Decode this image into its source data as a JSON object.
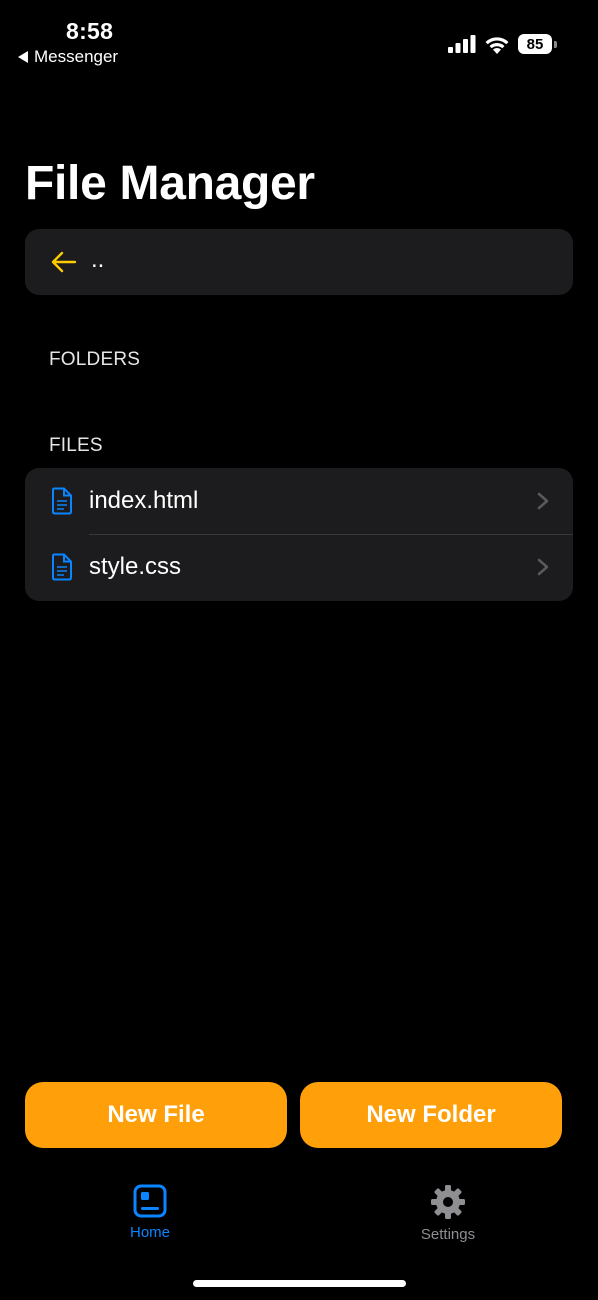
{
  "status_bar": {
    "time": "8:58",
    "back_app": "Messenger",
    "battery_level": "85"
  },
  "title": "File Manager",
  "parent_dir": {
    "label": "..",
    "icon": "arrow-left-icon"
  },
  "sections": {
    "folders_header": "FOLDERS",
    "files_header": "FILES"
  },
  "files": [
    {
      "name": "index.html",
      "icon": "document-icon"
    },
    {
      "name": "style.css",
      "icon": "document-icon"
    }
  ],
  "actions": {
    "new_file": "New File",
    "new_folder": "New Folder"
  },
  "tabs": [
    {
      "label": "Home",
      "icon": "home-icon",
      "active": true
    },
    {
      "label": "Settings",
      "icon": "gear-icon",
      "active": false
    }
  ],
  "colors": {
    "accent": "#ff9f0a",
    "back_arrow": "#ffcc00",
    "file_icon": "#0a84ff",
    "tab_active": "#0a84ff",
    "tab_inactive": "#8e8e93",
    "card": "#1c1c1e"
  }
}
